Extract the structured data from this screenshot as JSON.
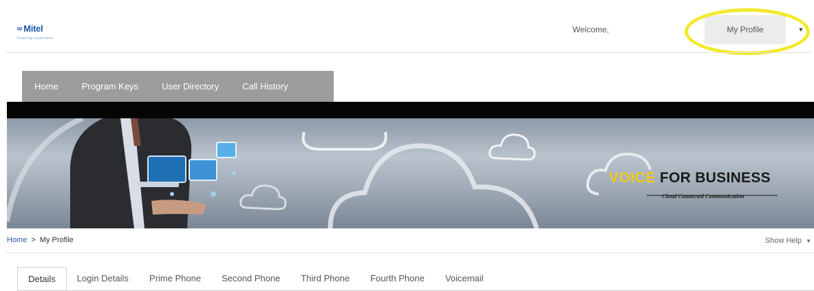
{
  "header": {
    "logo_mark": "∞",
    "logo_text": "Mitel",
    "logo_tagline": "Powering connections",
    "welcome": "Welcome,",
    "profile_button": "My Profile",
    "profile_caret_icon": "chevron-down-icon",
    "highlight_color": "#f2ea2a"
  },
  "nav": {
    "items": [
      "Home",
      "Program Keys",
      "User Directory",
      "Call History"
    ]
  },
  "banner": {
    "brand_highlight": "VOICE",
    "brand_rest": "FOR BUSINESS",
    "tagline": "Cloud Connected Communication",
    "highlight_color": "#f2c81a"
  },
  "breadcrumb": {
    "home": "Home",
    "separator": ">",
    "current": "My Profile",
    "show_help": "Show Help"
  },
  "tabs": {
    "active": "Details",
    "items": [
      "Details",
      "Login Details",
      "Prime Phone",
      "Second Phone",
      "Third Phone",
      "Fourth Phone",
      "Voicemail"
    ]
  }
}
